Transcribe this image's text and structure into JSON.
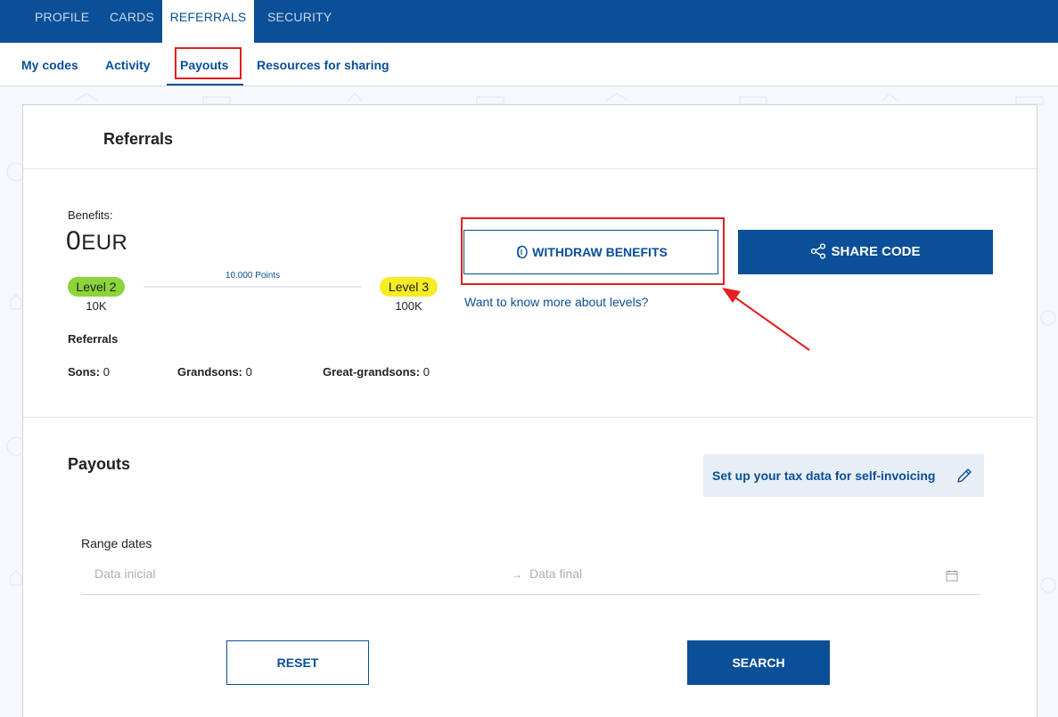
{
  "top_tabs": [
    {
      "label": "PROFILE"
    },
    {
      "label": "CARDS"
    },
    {
      "label": "REFERRALS",
      "active": true
    },
    {
      "label": "SECURITY"
    }
  ],
  "sub_tabs": [
    {
      "label": "My codes"
    },
    {
      "label": "Activity"
    },
    {
      "label": "Payouts",
      "active": true
    },
    {
      "label": "Resources for sharing"
    }
  ],
  "referrals_card": {
    "title": "Referrals",
    "benefits_label": "Benefits:",
    "benefits_amount": "0",
    "benefits_unit": "EUR",
    "current_level": {
      "label": "Level 2",
      "value": "10K",
      "color": "#8bd43a"
    },
    "next_level": {
      "label": "Level 3",
      "value": "100K",
      "color": "#f6ec25"
    },
    "points_to_next": "10.000 Points",
    "withdraw_label": "WITHDRAW BENEFITS",
    "share_label": "SHARE CODE",
    "levels_link": "Want to know more about levels?",
    "referrals_heading": "Referrals",
    "stats": [
      {
        "label": "Sons:",
        "value": "0"
      },
      {
        "label": "Grandsons:",
        "value": "0"
      },
      {
        "label": "Great-grandsons:",
        "value": "0"
      }
    ]
  },
  "payouts": {
    "title": "Payouts",
    "tax_button": "Set up your tax data for self-invoicing",
    "range_label": "Range dates",
    "start_placeholder": "Data inicial",
    "end_placeholder": "Data final",
    "reset_label": "RESET",
    "search_label": "SEARCH"
  },
  "colors": {
    "brand": "#0a4f98",
    "annotation": "#e41e1e"
  },
  "icons": [
    "coin-icon",
    "share-icon",
    "pencil-icon",
    "calendar-icon",
    "arrow-right-icon"
  ]
}
